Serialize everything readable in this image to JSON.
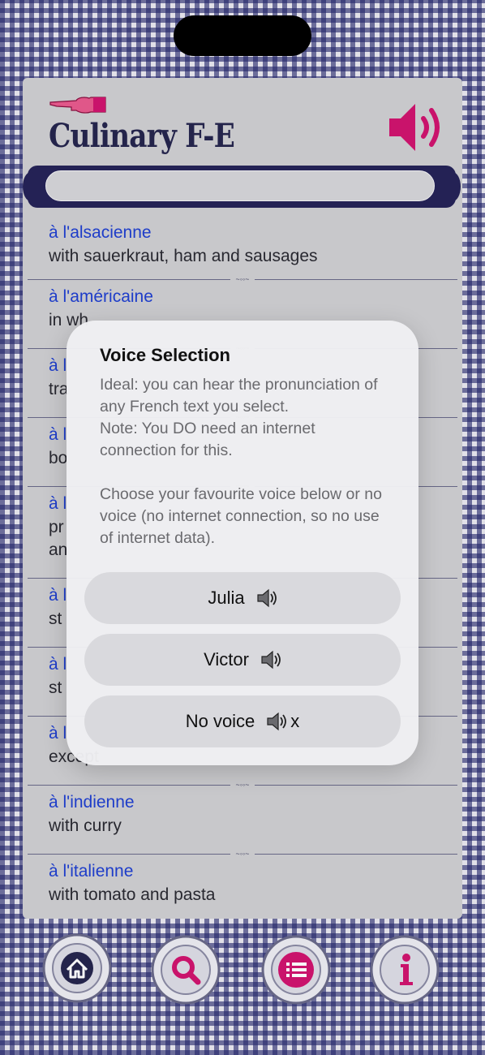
{
  "app": {
    "title": "Culinary F-E"
  },
  "search": {
    "value": ""
  },
  "entries": [
    {
      "fr": "à l'alsacienne",
      "en": "with sauerkraut, ham and sausages"
    },
    {
      "fr": "à l'américaine",
      "en": "in wh"
    },
    {
      "fr": "à l",
      "en": "tra"
    },
    {
      "fr": "à l",
      "en": "bo"
    },
    {
      "fr": "à l",
      "en": "pr",
      "en2": "an"
    },
    {
      "fr": "à l",
      "en": "st"
    },
    {
      "fr": "à l",
      "en": "st"
    },
    {
      "fr": "à l",
      "en": "except"
    },
    {
      "fr": "à l'indienne",
      "en": "with curry"
    },
    {
      "fr": "à l'italienne",
      "en": "with tomato and pasta"
    }
  ],
  "dialog": {
    "title": "Voice Selection",
    "line1": "Ideal: you can hear the pronunciation of any French text you select.",
    "line2": "Note: You DO need an internet connection for this.",
    "line3": "Choose your favourite voice below or no voice (no internet connection, so no use of internet data).",
    "buttons": [
      {
        "label": "Julia",
        "icon": "speaker-icon"
      },
      {
        "label": "Victor",
        "icon": "speaker-icon"
      },
      {
        "label": "No voice",
        "icon": "speaker-icon",
        "suffix": "x"
      }
    ]
  },
  "tabs": [
    {
      "icon": "home-icon"
    },
    {
      "icon": "search-icon"
    },
    {
      "icon": "list-icon"
    },
    {
      "icon": "info-icon"
    }
  ],
  "colors": {
    "accent": "#d0146f",
    "navy": "#26264e",
    "link": "#1f3fd0"
  }
}
